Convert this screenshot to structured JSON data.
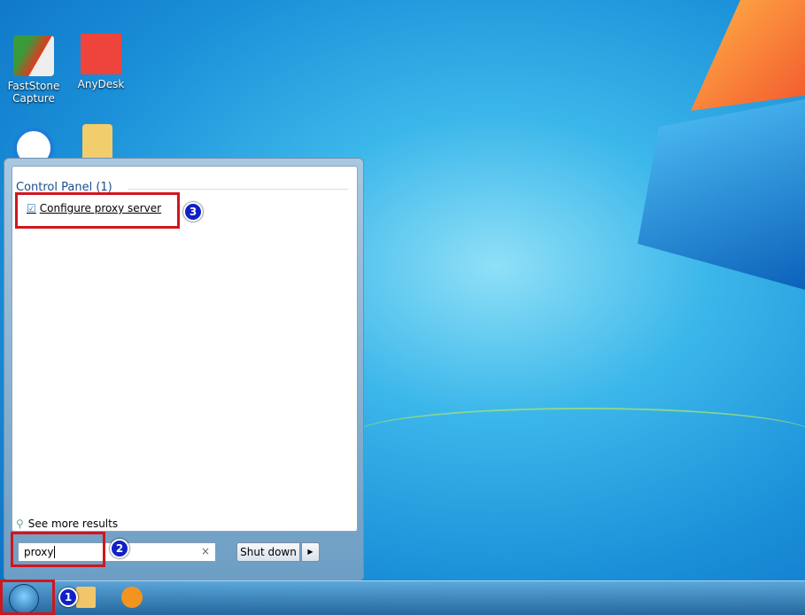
{
  "desktop": {
    "icons": [
      {
        "label": "FastStone Capture",
        "color": "#e24b2a"
      },
      {
        "label": "AnyDesk",
        "color": "#ef443b"
      },
      {
        "label": "",
        "color": "#1c7ed6"
      },
      {
        "label": "",
        "color": "#f2cd6b"
      }
    ]
  },
  "start_menu": {
    "group_header": "Control Panel (1)",
    "result_item": "Configure proxy server",
    "see_more": "See more results",
    "search_value": "proxy",
    "clear_symbol": "×",
    "shutdown_label": "Shut down",
    "shutdown_arrow": "▶"
  },
  "annotations": {
    "step1": "1",
    "step2": "2",
    "step3": "3",
    "highlight_color": "#d0161e"
  }
}
